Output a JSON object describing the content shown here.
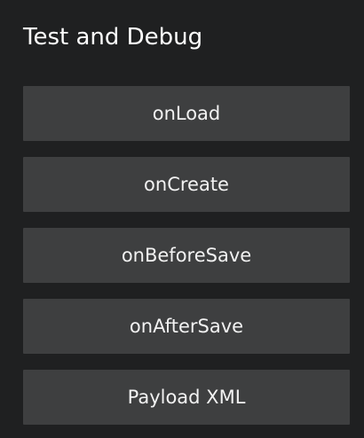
{
  "panel": {
    "title": "Test and Debug"
  },
  "buttons": [
    {
      "label": "onLoad"
    },
    {
      "label": "onCreate"
    },
    {
      "label": "onBeforeSave"
    },
    {
      "label": "onAfterSave"
    },
    {
      "label": "Payload XML"
    }
  ],
  "colors": {
    "background": "#1f2021",
    "button": "#3e3f40",
    "text": "#f2f2f2"
  }
}
